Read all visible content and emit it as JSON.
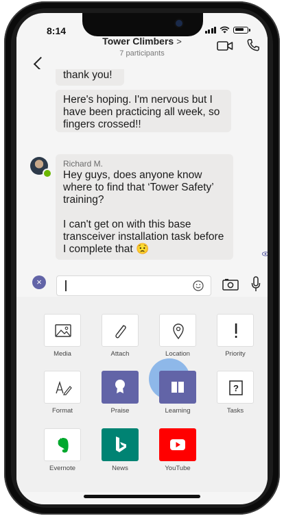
{
  "status_bar": {
    "time": "8:14"
  },
  "header": {
    "title": "Tower Climbers",
    "chevron": ">",
    "participants": "7 participants"
  },
  "messages": [
    {
      "text": "thank you!"
    },
    {
      "text": "Here's hoping. I'm nervous but I have been practicing all week, so fingers crossed!!"
    },
    {
      "sender": "Richard M.",
      "line1": "Hey guys, does anyone know where to find that ‘Tower Safety’ training?",
      "line2": "I can't get on with this base transceiver installation task before I complete that 😟"
    }
  ],
  "composer": {
    "placeholder": "",
    "close_glyph": "×"
  },
  "apps": [
    {
      "label": "Media",
      "icon": "image-icon"
    },
    {
      "label": "Attach",
      "icon": "paperclip-icon"
    },
    {
      "label": "Location",
      "icon": "location-pin-icon"
    },
    {
      "label": "Priority",
      "icon": "exclamation-icon"
    },
    {
      "label": "Format",
      "icon": "format-icon"
    },
    {
      "label": "Praise",
      "icon": "badge-icon",
      "color": "#6264a7"
    },
    {
      "label": "Learning",
      "icon": "book-icon",
      "color": "#6264a7"
    },
    {
      "label": "Tasks",
      "icon": "tasks-icon"
    },
    {
      "label": "Evernote",
      "icon": "evernote-icon",
      "color": "#00a82d"
    },
    {
      "label": "News",
      "icon": "bing-icon",
      "color": "#008373"
    },
    {
      "label": "YouTube",
      "icon": "youtube-icon",
      "color": "#ff0000"
    }
  ],
  "colors": {
    "accent": "#6264a7",
    "bubble": "#ebeae9",
    "presence": "#6bb700"
  }
}
